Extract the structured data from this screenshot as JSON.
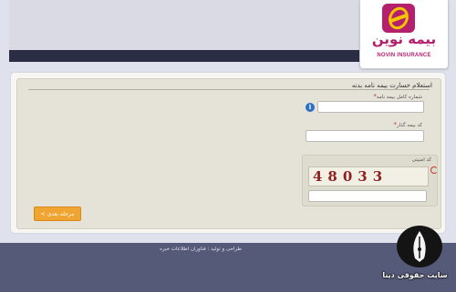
{
  "brand": {
    "name_fa": "بیمه نوین",
    "name_en": "NOVIN INSURANCE",
    "color": "#b5206e"
  },
  "form": {
    "title": "استعلام خسارت بیمه نامه بدنه",
    "policy_number_label": "شماره کامل بیمه نامه",
    "policy_number_value": "",
    "insured_code_label": "کد بیمه گذار",
    "insured_code_value": "",
    "security_code_label": "کد امنیتی",
    "captcha_text": "48033",
    "security_code_value": "",
    "required_mark": "*",
    "info_icon": "i",
    "next_button": "مرحله بعدی >"
  },
  "footer": {
    "credit": "طراحی و تولید : فناوران اطلاعات خبره"
  },
  "watermark": {
    "text": "سایت حقوقی دینا"
  },
  "colors": {
    "accent_button": "#f0a431",
    "footer_bg": "#555a78",
    "header_strip": "#2a2d44"
  }
}
